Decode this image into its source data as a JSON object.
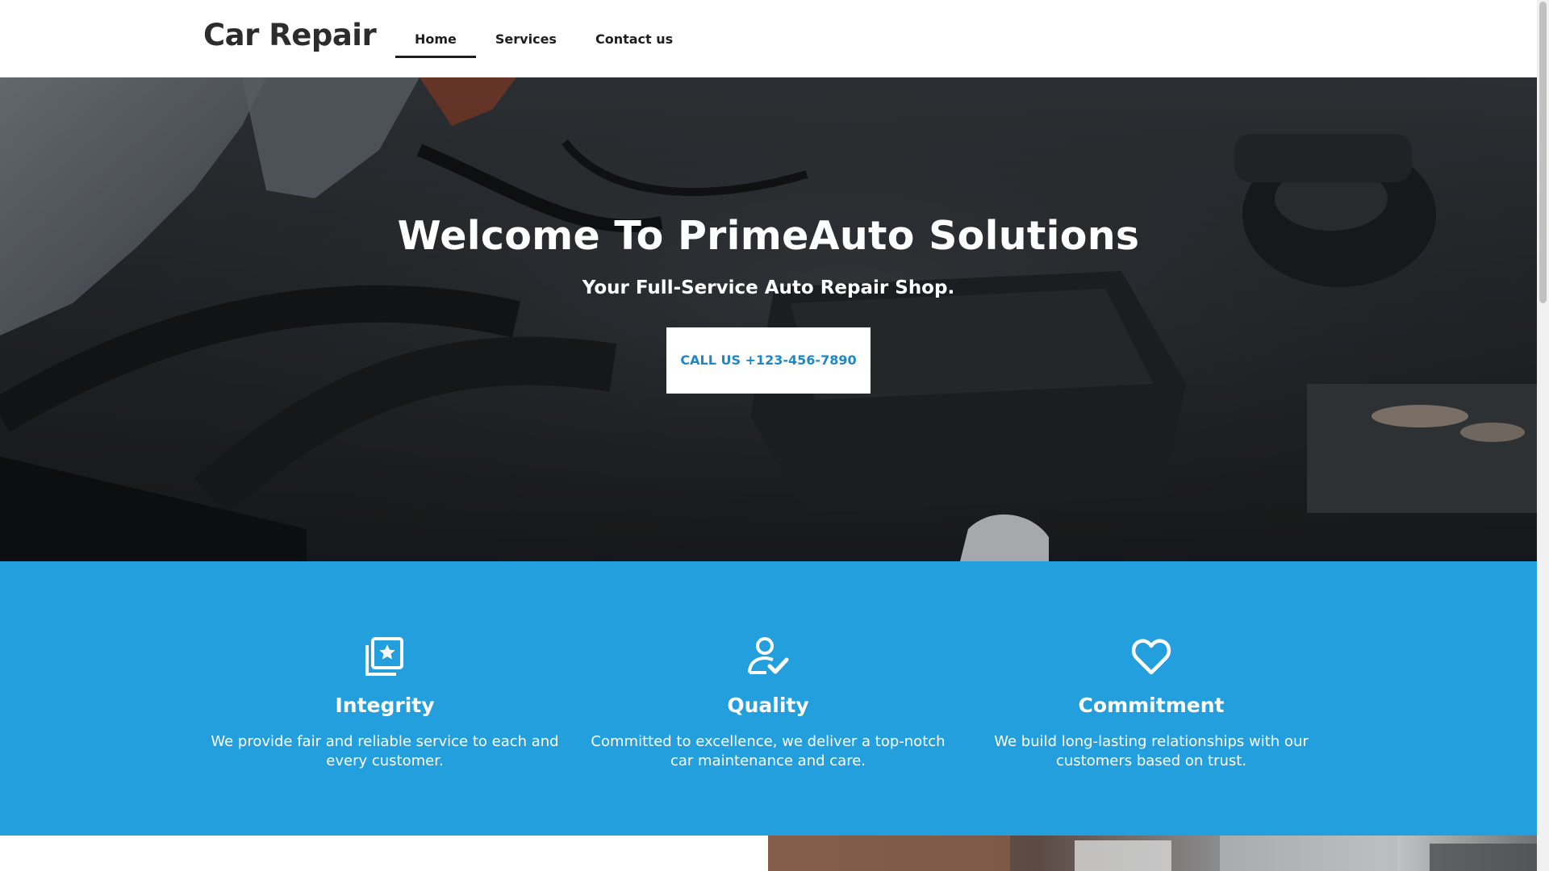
{
  "header": {
    "brand": "Car Repair",
    "nav": [
      {
        "label": "Home",
        "active": true
      },
      {
        "label": "Services",
        "active": false
      },
      {
        "label": "Contact us",
        "active": false
      }
    ]
  },
  "hero": {
    "title": "Welcome To PrimeAuto Solutions",
    "subtitle": "Your Full-Service Auto Repair Shop.",
    "cta_label": "CALL US +123-456-7890",
    "background_image": "car-engine-bay-photo"
  },
  "values": {
    "background_color": "#249fdd",
    "items": [
      {
        "icon": "star-badge-icon",
        "title": "Integrity",
        "description": "We provide fair and reliable service to each and every customer."
      },
      {
        "icon": "user-check-icon",
        "title": "Quality",
        "description": "Committed to excellence, we deliver a top-notch car maintenance and care."
      },
      {
        "icon": "heart-icon",
        "title": "Commitment",
        "description": "We build long-lasting relationships with our customers based on trust."
      }
    ]
  },
  "colors": {
    "accent": "#249fdd",
    "cta_text": "#1f87c4",
    "text_dark": "#1e1e1e"
  }
}
